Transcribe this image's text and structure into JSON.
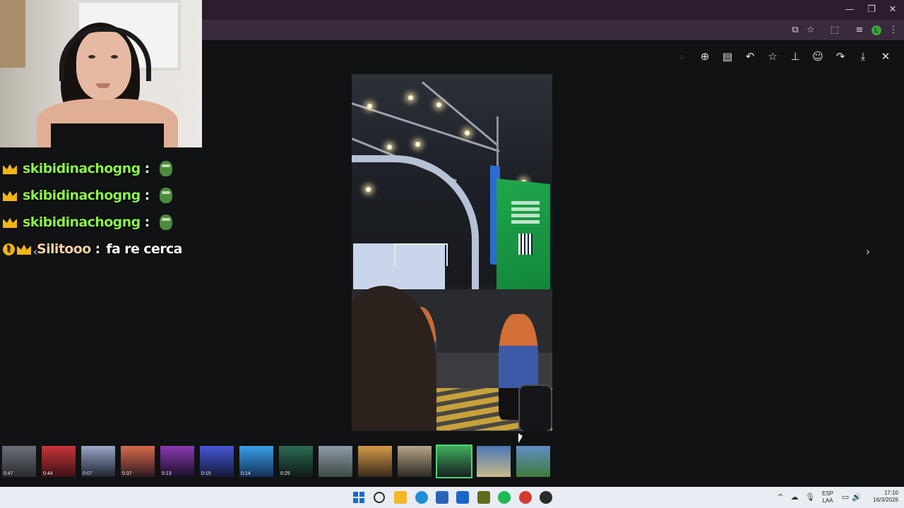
{
  "window": {
    "minimize": "—",
    "restore": "❐",
    "close": "✕"
  },
  "toolbar": {
    "cast_icon": "⧉",
    "bookmark_icon": "☆",
    "extensions_icon": "⬚",
    "media_icon": "≡",
    "profile_initial": "L",
    "menu_icon": "⋮"
  },
  "viewer": {
    "tools": [
      {
        "name": "zoom-out-icon",
        "glyph": "⌕",
        "enabled": false
      },
      {
        "name": "zoom-in-icon",
        "glyph": "⊕",
        "enabled": true
      },
      {
        "name": "caption-icon",
        "glyph": "▤",
        "enabled": true
      },
      {
        "name": "reply-icon",
        "glyph": "↶",
        "enabled": true
      },
      {
        "name": "star-icon",
        "glyph": "☆",
        "enabled": true
      },
      {
        "name": "pin-icon",
        "glyph": "⊥",
        "enabled": true
      },
      {
        "name": "emoji-icon",
        "glyph": "☺",
        "enabled": true
      },
      {
        "name": "forward-icon",
        "glyph": "↷",
        "enabled": true
      },
      {
        "name": "download-icon",
        "glyph": "⤓",
        "enabled": true
      },
      {
        "name": "close-icon",
        "glyph": "✕",
        "enabled": true
      }
    ],
    "prev_arrow": "‹",
    "next_arrow": "›"
  },
  "thumbnails": [
    {
      "duration": "0:47",
      "colors": [
        "#6c6f78",
        "#2a2c31"
      ]
    },
    {
      "duration": "0:44",
      "colors": [
        "#c9343a",
        "#3b1214"
      ]
    },
    {
      "duration": "0:07",
      "colors": [
        "#9aa6c8",
        "#1f2433"
      ]
    },
    {
      "duration": "0:37",
      "colors": [
        "#d96a4a",
        "#2f1a22"
      ]
    },
    {
      "duration": "0:13",
      "colors": [
        "#8b3bb3",
        "#1b0f2a"
      ]
    },
    {
      "duration": "0:15",
      "colors": [
        "#4857d6",
        "#151a3a"
      ]
    },
    {
      "duration": "0:14",
      "colors": [
        "#3aa0e8",
        "#123058"
      ]
    },
    {
      "duration": "0:25",
      "colors": [
        "#2b6b52",
        "#0e1a18"
      ]
    },
    {
      "duration": "",
      "colors": [
        "#8e9aa8",
        "#3e4a44"
      ]
    },
    {
      "duration": "",
      "colors": [
        "#d59a4a",
        "#3a2a1a"
      ]
    },
    {
      "duration": "",
      "colors": [
        "#b5a58a",
        "#2e2a24"
      ]
    },
    {
      "duration": "",
      "colors": [
        "#3fae5c",
        "#1a1f24"
      ],
      "selected": true
    },
    {
      "duration": "",
      "colors": [
        "#4a78b8",
        "#c9b98a"
      ]
    },
    {
      "duration": "",
      "colors": [
        "#5f8fc6",
        "#3f7a3a"
      ]
    }
  ],
  "chat": [
    {
      "badges": [
        "crown"
      ],
      "user": "skibidinachogng",
      "separator": ":",
      "message": "",
      "emote": "pepe-emote",
      "user_color": "green"
    },
    {
      "badges": [
        "crown"
      ],
      "user": "skibidinachogng",
      "separator": ":",
      "message": "",
      "emote": "pepe-emote",
      "user_color": "green"
    },
    {
      "badges": [
        "crown"
      ],
      "user": "skibidinachogng",
      "separator": ":",
      "message": "",
      "emote": "pepe-emote",
      "user_color": "green"
    },
    {
      "badges": [
        "info",
        "crown"
      ],
      "user": "Silitooo",
      "separator": ":",
      "message": "fa re cerca",
      "emote": "",
      "user_color": "peach"
    }
  ],
  "taskbar": {
    "apps": [
      {
        "name": "search-icon",
        "color": "#2a2a2a"
      },
      {
        "name": "file-explorer-icon",
        "color": "#f2b824"
      },
      {
        "name": "edge-icon",
        "color": "#1f8fd8"
      },
      {
        "name": "calculator-icon",
        "color": "#2b63b8"
      },
      {
        "name": "outlook-icon",
        "color": "#1a66c8"
      },
      {
        "name": "game-app-icon",
        "color": "#5f6b1e"
      },
      {
        "name": "spotify-icon",
        "color": "#1db954"
      },
      {
        "name": "chrome-icon",
        "color": "#d33b2f"
      },
      {
        "name": "obs-icon",
        "color": "#2a2a2a"
      }
    ],
    "tray": {
      "chevron": "^",
      "lang_top": "ESP",
      "lang_bottom": "LAA",
      "time": "17:10",
      "date": "16/3/2026"
    }
  }
}
